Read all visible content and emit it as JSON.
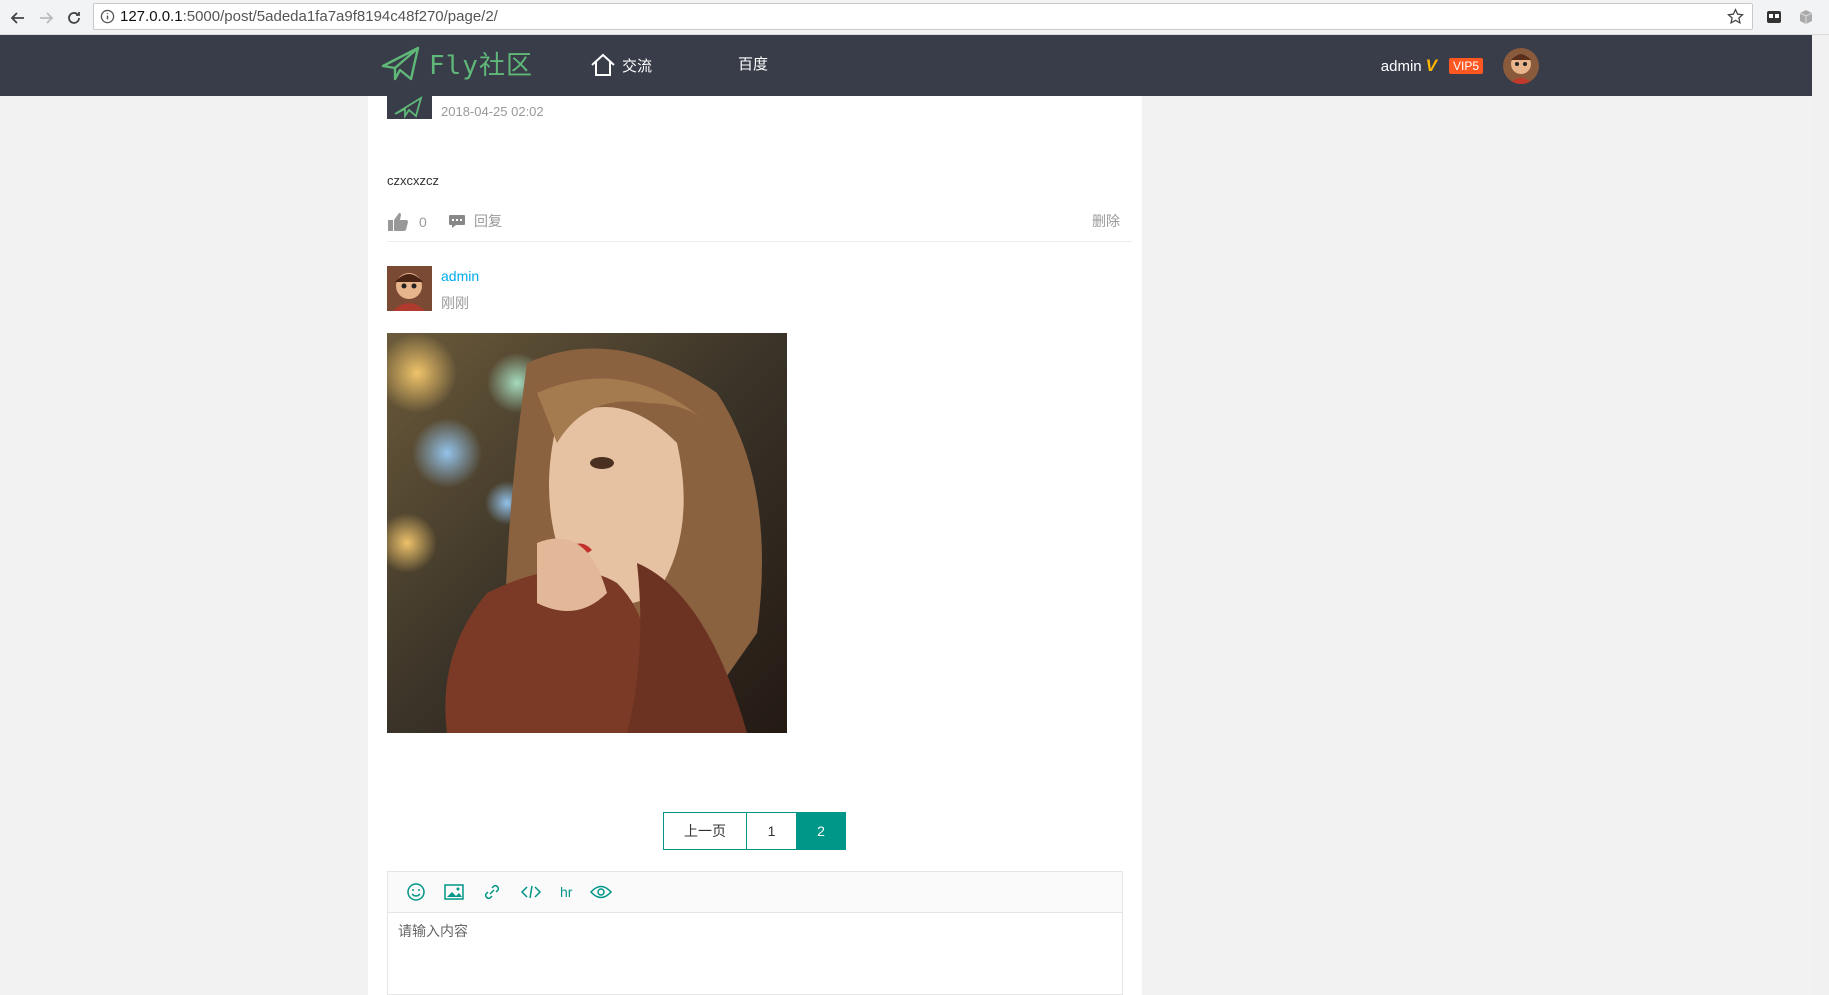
{
  "browser": {
    "url_host": "127.0.0.1",
    "url_rest": ":5000/post/5adeda1fa7a9f8194c48f270/page/2/"
  },
  "header": {
    "logo_text": "Fly社区",
    "nav": [
      {
        "label": "交流"
      },
      {
        "label": "百度"
      }
    ],
    "user": {
      "name": "admin",
      "verified_mark": "V",
      "vip": "VIP5"
    },
    "colors": {
      "header_bg": "#393d49",
      "logo": "#5FB878",
      "vip": "#FF5722"
    }
  },
  "reply": {
    "date": "2018-04-25 02:02",
    "content": "czxcxzcz",
    "likes": "0",
    "reply_label": "回复",
    "delete_label": "删除"
  },
  "comment": {
    "author": "admin",
    "time": "刚刚"
  },
  "pagination": {
    "prev_label": "上一页",
    "pages": [
      "1",
      "2"
    ],
    "current": "2",
    "accent": "#009688"
  },
  "editor": {
    "toolbar": [
      {
        "icon": "face-icon"
      },
      {
        "icon": "image-icon"
      },
      {
        "icon": "link-icon"
      },
      {
        "icon": "code-icon"
      },
      {
        "label": "hr"
      },
      {
        "icon": "preview-eye-icon"
      }
    ],
    "placeholder": "请输入内容"
  }
}
